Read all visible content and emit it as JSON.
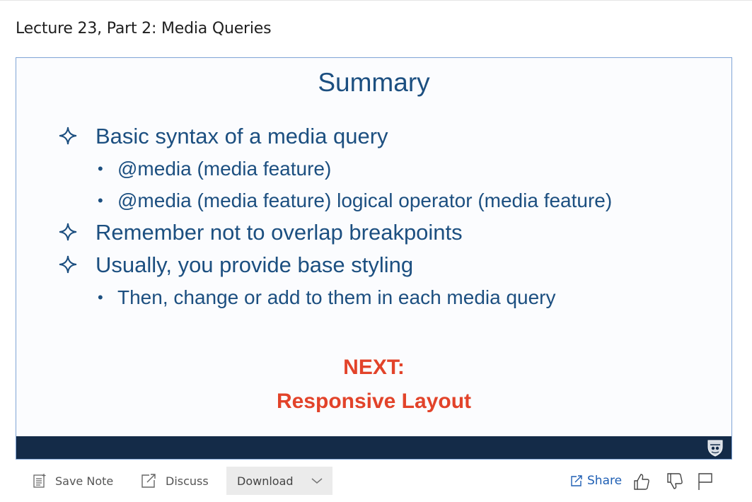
{
  "page": {
    "title": "Lecture 23, Part 2: Media Queries"
  },
  "slide": {
    "title": "Summary",
    "bullets": [
      {
        "text": "Basic syntax of a media query"
      },
      {
        "text": "@media (media feature)"
      },
      {
        "text": "@media (media feature) logical operator (media feature)"
      },
      {
        "text": "Remember not to overlap breakpoints"
      },
      {
        "text": "Usually, you provide base styling"
      },
      {
        "text": "Then, change or add to them in each media query"
      }
    ],
    "next_label": "NEXT:",
    "next_title": "Responsive Layout",
    "colors": {
      "title": "#1c4f80",
      "accent": "#e2432a",
      "bar": "#142b48"
    }
  },
  "toolbar": {
    "save_note": "Save Note",
    "discuss": "Discuss",
    "download": "Download",
    "share": "Share",
    "link_color": "#1f5fb4"
  }
}
